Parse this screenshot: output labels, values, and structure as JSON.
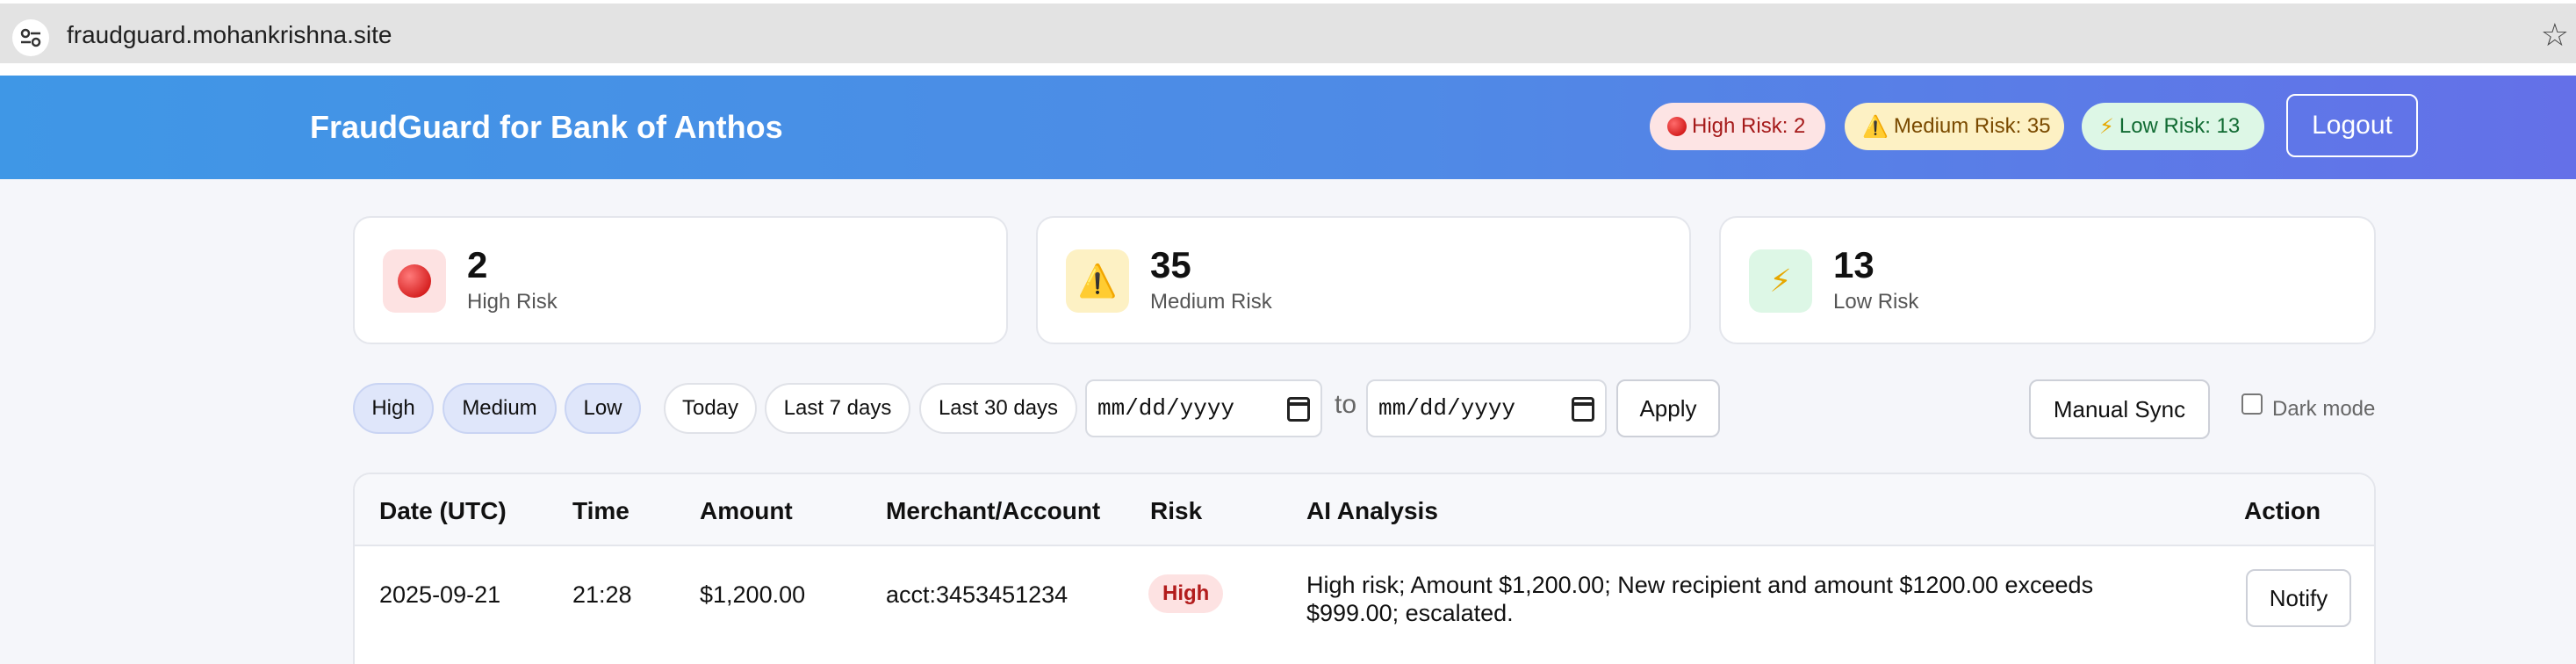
{
  "browser": {
    "url": "fraudguard.mohankrishna.site",
    "site_info_icon": "tune-icon",
    "bookmark_icon": "star-icon"
  },
  "header": {
    "title": "FraudGuard for Bank of Anthos",
    "badges": {
      "high": "High Risk: 2",
      "medium": "Medium Risk: 35",
      "low": "Low Risk: 13"
    },
    "logout_label": "Logout"
  },
  "stats": [
    {
      "value": "2",
      "label": "High Risk",
      "icon": "red-circle-icon"
    },
    {
      "value": "35",
      "label": "Medium Risk",
      "icon": "warning-icon"
    },
    {
      "value": "13",
      "label": "Low Risk",
      "icon": "lightning-icon"
    }
  ],
  "filters": {
    "risk_chips": [
      "High",
      "Medium",
      "Low"
    ],
    "ranges": [
      "Today",
      "Last 7 days",
      "Last 30 days"
    ],
    "from_date": "mm/dd/yyyy",
    "to_label": "to",
    "to_date": "mm/dd/yyyy",
    "apply_label": "Apply",
    "sync_label": "Manual Sync",
    "dark_mode_label": "Dark mode",
    "dark_mode_checked": false
  },
  "table": {
    "columns": [
      "Date (UTC)",
      "Time",
      "Amount",
      "Merchant/Account",
      "Risk",
      "AI Analysis",
      "Action"
    ],
    "rows": [
      {
        "date": "2025-09-21",
        "time": "21:28",
        "amount": "$1,200.00",
        "account": "acct:3453451234",
        "risk": "High",
        "analysis": "High risk; Amount $1,200.00; New recipient and amount $1200.00 exceeds $999.00; escalated.",
        "action": "Notify"
      }
    ]
  },
  "colors": {
    "header_gradient_start": "#3f97e6",
    "header_gradient_end": "#6470e8",
    "high": "#b21c1c",
    "medium": "#7a4a00",
    "low": "#116b33"
  }
}
